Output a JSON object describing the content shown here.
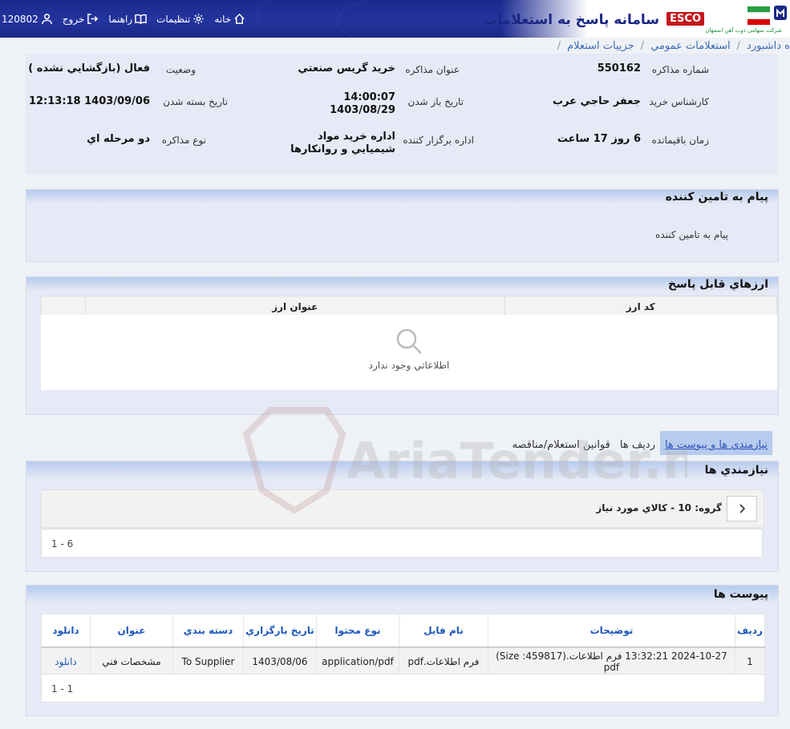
{
  "colors": {
    "header": "#1b2785",
    "accent": "#1d57b9",
    "esco": "#c4161c"
  },
  "header": {
    "title": "سامانه پاسخ به استعلامات",
    "brand": "ESCO",
    "company_line": "شرکت سهامی ذوب آهن اصفهان",
    "user_code": "120802",
    "logout": "خروج",
    "help": "راهنما",
    "settings": "تنظیمات",
    "home": "خانه"
  },
  "breadcrumb": [
    "ه داشبورد",
    "استعلامات عمومي",
    "جزييات استعلام"
  ],
  "info": {
    "number_label": "شماره مذاکره",
    "number": "550162",
    "subject_label": "عنوان مذاکره",
    "subject": "خريد گريس صنعتي",
    "status_label": "وضعيت",
    "status": "فعال (بازگشايي نشده )",
    "expert_label": "کارشناس خريد",
    "expert": "جعفر حاجي عرب",
    "open_label": "تاريخ باز شدن",
    "open_time": "14:00:07",
    "open_date": "1403/08/29",
    "close_label": "تاريخ بسته شدن",
    "close": "1403/09/06 12:13:18",
    "remaining_label": "زمان باقيمانده",
    "remaining": "6 روز 17 ساعت",
    "org_label": "اداره برگزار کننده",
    "org_line1": "اداره خريد مواد",
    "org_line2": "شيميايي و روانکارها",
    "type_label": "نوع مذاکره",
    "type": "دو مرحله اي"
  },
  "supplier_msg": {
    "title": "پيام به تامين کننده",
    "body": "پيام به تامين کننده"
  },
  "currencies": {
    "title": "ارزهاي قابل پاسخ",
    "col_code": "کد ارز",
    "col_title": "عنوان ارز",
    "empty": "اطلاعاتي وجود ندارد"
  },
  "tabs": [
    {
      "label": "نيازمندي ها و پيوست ها",
      "active": true
    },
    {
      "label": "رديف ها",
      "active": false
    },
    {
      "label": "قوانين استعلام/مناقصه",
      "active": false
    }
  ],
  "needs": {
    "title": "نيازمندي ها",
    "group": "گروه: 10 - کالاي مورد نياز",
    "pager": "1 - 6"
  },
  "attachments": {
    "title": "پيوست ها",
    "headers": [
      "رديف",
      "توضيحات",
      "نام فايل",
      "نوع محتوا",
      "تاريخ بارگزاري",
      "دسته بندي",
      "عنوان",
      "دانلود"
    ],
    "rows": [
      [
        "1",
        "2024-10-27 13:32:21 فرم اطلاعات.(Size :459817) pdf",
        "فرم اطلاعات.pdf",
        "application/pdf",
        "1403/08/06",
        "To Supplier",
        "مشخصات فني",
        "دانلود"
      ]
    ],
    "pager": "1 - 1"
  },
  "watermark": "AriaTender.neT"
}
